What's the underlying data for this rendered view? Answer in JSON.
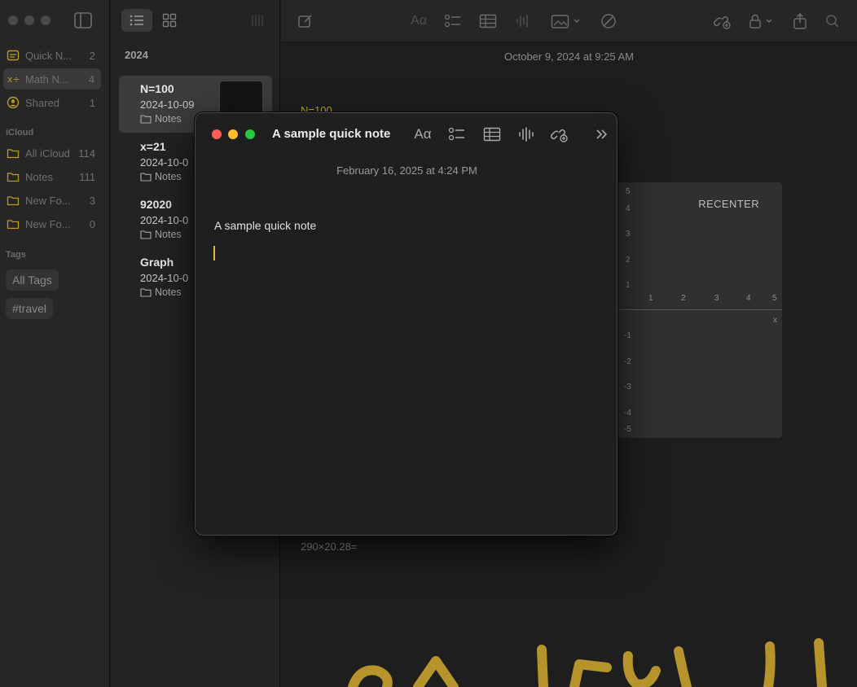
{
  "sidebar": {
    "items_top": [
      {
        "label": "Quick N...",
        "count": "2",
        "icon": "quick-notes-icon"
      },
      {
        "label": "Math N...",
        "count": "4",
        "icon": "math-notes-icon"
      },
      {
        "label": "Shared",
        "count": "1",
        "icon": "shared-icon"
      }
    ],
    "icloud_label": "iCloud",
    "icloud_items": [
      {
        "label": "All iCloud",
        "count": "114",
        "icon": "folder-icon"
      },
      {
        "label": "Notes",
        "count": "111",
        "icon": "folder-icon"
      },
      {
        "label": "New Fo...",
        "count": "3",
        "icon": "folder-icon"
      },
      {
        "label": "New Fo...",
        "count": "0",
        "icon": "folder-icon"
      }
    ],
    "tags_label": "Tags",
    "tags": [
      "All Tags",
      "#travel"
    ]
  },
  "notelist": {
    "year": "2024",
    "notes": [
      {
        "title": "N=100",
        "date": "2024-10-09",
        "folder": "Notes"
      },
      {
        "title": "x=21",
        "date": "2024-10-0",
        "folder": "Notes"
      },
      {
        "title": "92020",
        "date": "2024-10-0",
        "folder": "Notes"
      },
      {
        "title": "Graph",
        "date": "2024-10-0",
        "folder": "Notes"
      }
    ]
  },
  "main": {
    "date": "October 9, 2024 at 9:25 AM",
    "heading": "N=100",
    "calc": "290×20.28=",
    "graph": {
      "recenter_label": "RECENTER",
      "y_ticks_top": [
        "5",
        "4",
        "3",
        "2",
        "1"
      ],
      "x_ticks": [
        "1",
        "2",
        "3",
        "4",
        "5"
      ],
      "x_label": "x",
      "y_ticks_bottom": [
        "-1",
        "-2",
        "-3",
        "-4",
        "-5"
      ]
    }
  },
  "quicknote": {
    "title": "A sample quick note",
    "date": "February 16, 2025 at 4:24 PM",
    "body": "A sample quick note"
  },
  "colors": {
    "accent": "#e2b340",
    "close": "#ff5f57",
    "minimize": "#febc2e",
    "zoom": "#28c840"
  }
}
